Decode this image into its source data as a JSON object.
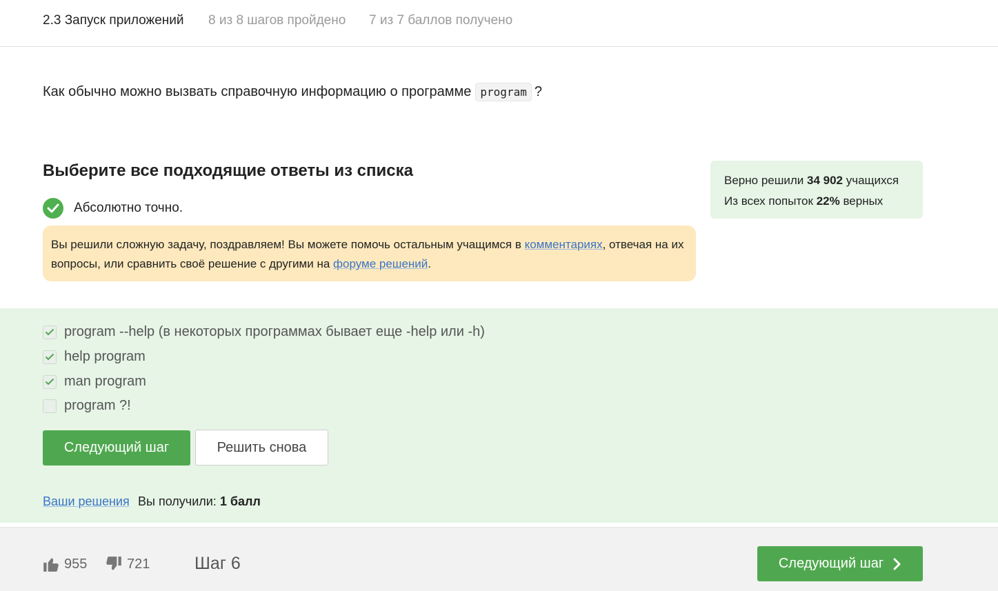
{
  "header": {
    "lesson_title": "2.3 Запуск приложений",
    "steps_progress": "8 из 8 шагов пройдено",
    "points_progress": "7 из 7 баллов  получено"
  },
  "question": {
    "text": "Как обычно можно вызвать справочную информацию о программе",
    "code": "program",
    "suffix": "?"
  },
  "task": {
    "title": "Выберите все подходящие ответы из списка",
    "result_text": "Абсолютно точно.",
    "congrats": {
      "part1": "Вы решили сложную задачу, поздравляем! Вы можете помочь остальным учащимся в ",
      "link_comments": "комментариях",
      "part2": ", отвечая на их вопросы, или сравнить своё решение с другими на ",
      "link_forum": "форуме решений",
      "part3": "."
    }
  },
  "stats": {
    "solved_prefix": "Верно решили ",
    "solved_count": "34 902",
    "solved_suffix": " учащихся",
    "attempts_prefix": "Из всех попыток ",
    "attempts_percent": "22%",
    "attempts_suffix": " верных"
  },
  "options": [
    {
      "label": "program --help (в некоторых программах бывает еще -help или -h)",
      "checked": true
    },
    {
      "label": "help program",
      "checked": true
    },
    {
      "label": "man program",
      "checked": true
    },
    {
      "label": "program ?!",
      "checked": false
    }
  ],
  "buttons": {
    "next_step": "Следующий шаг",
    "solve_again": "Решить снова"
  },
  "submission": {
    "solutions_link": "Ваши решения",
    "score_prefix": "Вы получили: ",
    "score_value": "1 балл"
  },
  "footer": {
    "likes": "955",
    "dislikes": "721",
    "step_label": "Шаг 6",
    "next_button": "Следующий шаг"
  },
  "colors": {
    "accent_green": "#4fa84f",
    "success_bg": "#e6f5e6",
    "notice_bg": "#fde9bd",
    "link": "#3a74c6"
  }
}
